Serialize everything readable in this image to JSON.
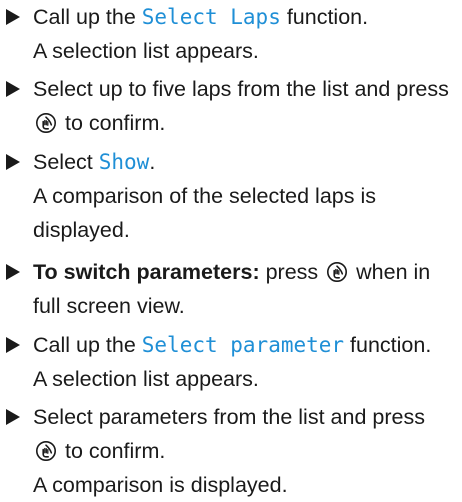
{
  "steps": [
    {
      "parts": [
        {
          "text": "Call up the "
        },
        {
          "text": "Select Laps",
          "style": "ui"
        },
        {
          "text": " function."
        }
      ],
      "result_lines": [
        "A selection list appears."
      ]
    },
    {
      "line1": "Select up to five laps from the list and press",
      "line2_after_icon": " to confirm.",
      "icon": "controller-knob-icon"
    },
    {
      "parts": [
        {
          "text": "Select "
        },
        {
          "text": "Show",
          "style": "ui"
        },
        {
          "text": "."
        }
      ],
      "result_lines": [
        "A comparison of the selected laps is",
        "displayed."
      ]
    },
    {
      "bold_label": "To switch parameters:",
      "text_before_icon": " press ",
      "text_after_icon": " when in",
      "line2": "full screen view.",
      "icon": "controller-knob-icon"
    },
    {
      "parts": [
        {
          "text": "Call up the "
        },
        {
          "text": "Select parameter",
          "style": "ui"
        },
        {
          "text": " function."
        }
      ],
      "result_lines": [
        "A selection list appears."
      ]
    },
    {
      "line1": "Select parameters from the list and press",
      "line2_after_icon": " to confirm.",
      "result_lines": [
        "A comparison is displayed."
      ],
      "icon": "controller-knob-icon"
    }
  ],
  "colors": {
    "ui_text": "#1f8fd6",
    "body_text": "#1a1a1a"
  }
}
